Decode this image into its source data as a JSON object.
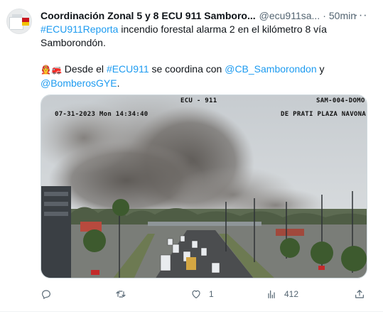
{
  "tweet": {
    "author_name": "Coordinación Zonal 5 y 8 ECU 911 Samboro...",
    "handle": "@ecu911sa...",
    "separator": "·",
    "time": "50min",
    "line1_hashtag": "#ECU911Reporta",
    "line1_rest": " incendio forestal alarma 2 en el kilómetro 8 vía",
    "line2": "Samborondón.",
    "line3_emojis": "👨‍🚒🚒",
    "line3_prefix": " Desde el ",
    "line3_hashtag": "#ECU911",
    "line3_mid": " se coordina con ",
    "line3_mention": "@CB_Samborondon",
    "line3_suffix": " y",
    "line4_mention": "@BomberosGYE",
    "line4_suffix": "."
  },
  "media": {
    "overlay_center": "ECU - 911",
    "overlay_right": "SAM-004-DOMO",
    "overlay_datetime": "07-31-2023 Mon 14:34:40",
    "overlay_location": "DE PRATI PLAZA NAVONA"
  },
  "actions": {
    "reply_count": "",
    "retweet_count": "",
    "like_count": "1",
    "views_count": "412"
  },
  "colors": {
    "link": "#1d9bf0",
    "secondary_text": "#536471",
    "primary_text": "#0f1419"
  }
}
